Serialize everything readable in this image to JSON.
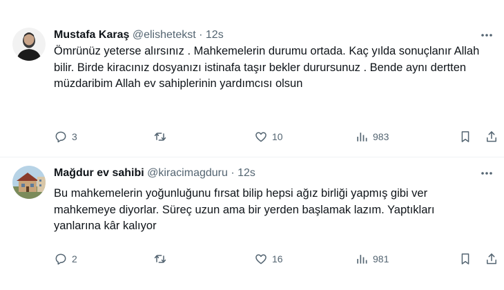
{
  "tweets": [
    {
      "author": {
        "name": "Mustafa Karaş",
        "handle": "@elishetekst"
      },
      "separator": "·",
      "time": "12s",
      "text": "Ömrünüz yeterse alırsınız . Mahkemelerin durumu ortada. Kaç yılda sonuçlanır Allah bilir. Birde kiracınız dosyanızı istinafa taşır bekler durursunuz . Bende aynı dertten müzdaribim Allah ev sahiplerinin yardımcısı olsun",
      "stats": {
        "replies": "3",
        "reposts": "",
        "likes": "10",
        "views": "983"
      }
    },
    {
      "author": {
        "name": "Mağdur ev sahibi",
        "handle": "@kiracimagduru"
      },
      "separator": "·",
      "time": "12s",
      "text": "Bu mahkemelerin yoğunluğunu fırsat bilip hepsi ağız birliği yapmış gibi ver mahkemeye diyorlar. Süreç uzun ama bir yerden başlamak lazım. Yaptıkları yanlarına kâr kalıyor",
      "stats": {
        "replies": "2",
        "reposts": "",
        "likes": "16",
        "views": "981"
      }
    }
  ],
  "icons": {
    "more": "more-horizontal-icon",
    "reply": "reply-icon",
    "repost": "repost-icon",
    "like": "heart-icon",
    "views": "views-chart-icon",
    "bookmark": "bookmark-icon",
    "share": "share-icon"
  },
  "colors": {
    "text": "#0f1419",
    "secondary": "#536471",
    "divider": "#eff3f4"
  }
}
